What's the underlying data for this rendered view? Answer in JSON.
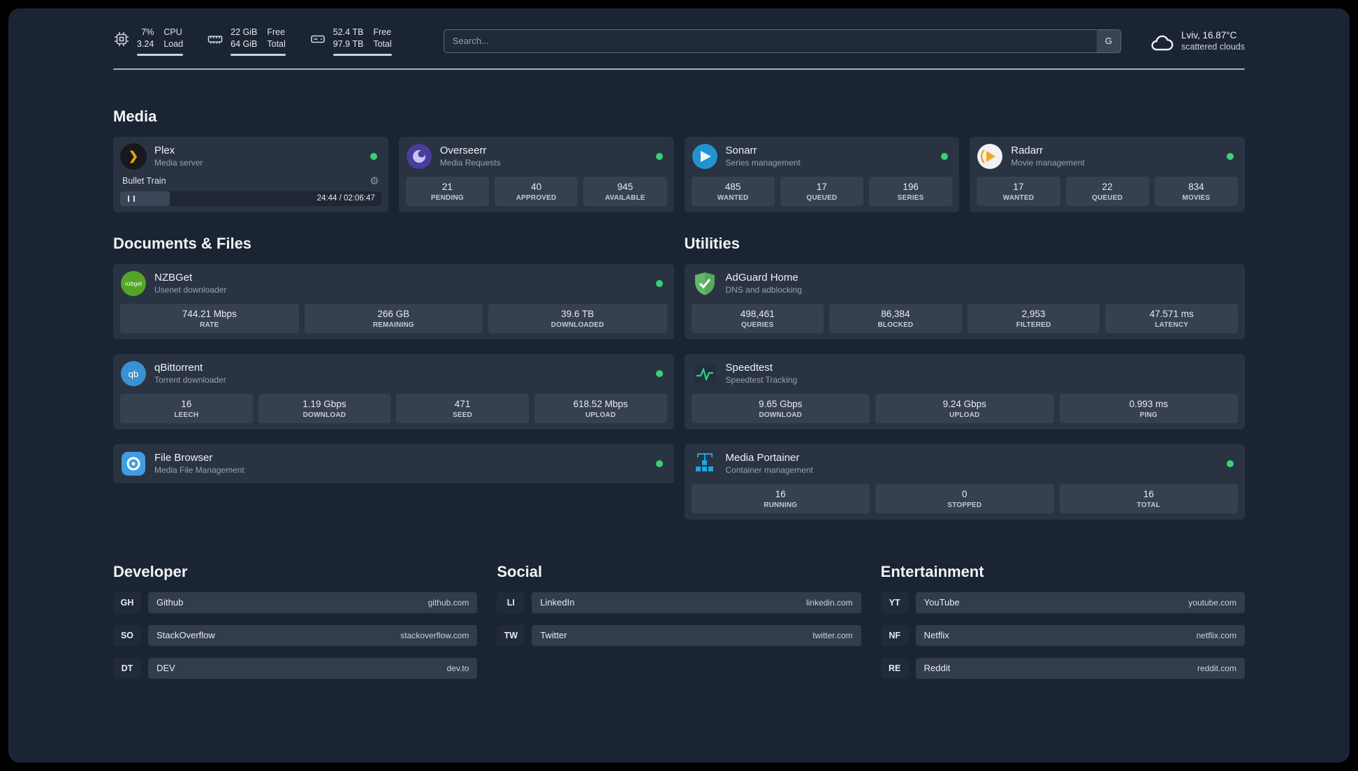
{
  "topbar": {
    "cpu": {
      "value1": "7%",
      "value2": "3.24",
      "label1": "CPU",
      "label2": "Load"
    },
    "memory": {
      "value1": "22 GiB",
      "value2": "64 GiB",
      "label1": "Free",
      "label2": "Total"
    },
    "disk": {
      "value1": "52.4 TB",
      "value2": "97.9 TB",
      "label1": "Free",
      "label2": "Total"
    },
    "search": {
      "placeholder": "Search...",
      "button": "G"
    },
    "weather": {
      "location": "Lviv, 16.87°C",
      "condition": "scattered clouds"
    }
  },
  "sections": {
    "media": "Media",
    "documents": "Documents & Files",
    "utilities": "Utilities",
    "developer": "Developer",
    "social": "Social",
    "entertainment": "Entertainment"
  },
  "media_cards": [
    {
      "name": "Plex",
      "subtitle": "Media server",
      "player": {
        "title": "Bullet Train",
        "time": "24:44 / 02:06:47"
      }
    },
    {
      "name": "Overseerr",
      "subtitle": "Media Requests",
      "stats": [
        {
          "value": "21",
          "label": "PENDING"
        },
        {
          "value": "40",
          "label": "APPROVED"
        },
        {
          "value": "945",
          "label": "AVAILABLE"
        }
      ]
    },
    {
      "name": "Sonarr",
      "subtitle": "Series management",
      "stats": [
        {
          "value": "485",
          "label": "WANTED"
        },
        {
          "value": "17",
          "label": "QUEUED"
        },
        {
          "value": "196",
          "label": "SERIES"
        }
      ]
    },
    {
      "name": "Radarr",
      "subtitle": "Movie management",
      "stats": [
        {
          "value": "17",
          "label": "WANTED"
        },
        {
          "value": "22",
          "label": "QUEUED"
        },
        {
          "value": "834",
          "label": "MOVIES"
        }
      ]
    }
  ],
  "documents_cards": [
    {
      "name": "NZBGet",
      "subtitle": "Usenet downloader",
      "stats": [
        {
          "value": "744.21 Mbps",
          "label": "RATE"
        },
        {
          "value": "266 GB",
          "label": "REMAINING"
        },
        {
          "value": "39.6 TB",
          "label": "DOWNLOADED"
        }
      ]
    },
    {
      "name": "qBittorrent",
      "subtitle": "Torrent downloader",
      "stats": [
        {
          "value": "16",
          "label": "LEECH"
        },
        {
          "value": "1.19 Gbps",
          "label": "DOWNLOAD"
        },
        {
          "value": "471",
          "label": "SEED"
        },
        {
          "value": "618.52 Mbps",
          "label": "UPLOAD"
        }
      ]
    },
    {
      "name": "File Browser",
      "subtitle": "Media File Management"
    }
  ],
  "utilities_cards": [
    {
      "name": "AdGuard Home",
      "subtitle": "DNS and adblocking",
      "stats": [
        {
          "value": "498,461",
          "label": "QUERIES"
        },
        {
          "value": "86,384",
          "label": "BLOCKED"
        },
        {
          "value": "2,953",
          "label": "FILTERED"
        },
        {
          "value": "47.571 ms",
          "label": "LATENCY"
        }
      ]
    },
    {
      "name": "Speedtest",
      "subtitle": "Speedtest Tracking",
      "stats": [
        {
          "value": "9.65 Gbps",
          "label": "DOWNLOAD"
        },
        {
          "value": "9.24 Gbps",
          "label": "UPLOAD"
        },
        {
          "value": "0.993 ms",
          "label": "PING"
        }
      ]
    },
    {
      "name": "Media Portainer",
      "subtitle": "Container management",
      "stats": [
        {
          "value": "16",
          "label": "RUNNING"
        },
        {
          "value": "0",
          "label": "STOPPED"
        },
        {
          "value": "16",
          "label": "TOTAL"
        }
      ]
    }
  ],
  "bookmarks": {
    "developer": [
      {
        "abbr": "GH",
        "name": "Github",
        "url": "github.com"
      },
      {
        "abbr": "SO",
        "name": "StackOverflow",
        "url": "stackoverflow.com"
      },
      {
        "abbr": "DT",
        "name": "DEV",
        "url": "dev.to"
      }
    ],
    "social": [
      {
        "abbr": "LI",
        "name": "LinkedIn",
        "url": "linkedin.com"
      },
      {
        "abbr": "TW",
        "name": "Twitter",
        "url": "twitter.com"
      }
    ],
    "entertainment": [
      {
        "abbr": "YT",
        "name": "YouTube",
        "url": "youtube.com"
      },
      {
        "abbr": "NF",
        "name": "Netflix",
        "url": "netflix.com"
      },
      {
        "abbr": "RE",
        "name": "Reddit",
        "url": "reddit.com"
      }
    ]
  },
  "icons": {
    "plex_chevron": "❯",
    "gear": "⚙",
    "nzbget_text": "nzbget",
    "qbittorrent_text": "qb"
  },
  "colors": {
    "status_online": "#3bd077",
    "background": "#1b2433",
    "card": "#2a3342",
    "tile": "#36404f"
  }
}
